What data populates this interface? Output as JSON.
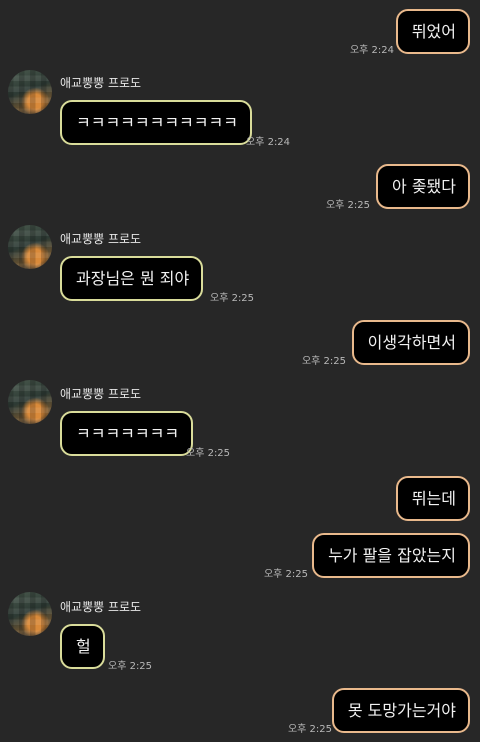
{
  "sender_name": "애교뿡뿡 프로도",
  "messages": [
    {
      "from": "me",
      "text": "뛰었어",
      "time": "오후 2:24"
    },
    {
      "from": "them",
      "text": "ㅋㅋㅋㅋㅋㅋㅋㅋㅋㅋㅋ",
      "time": "오후 2:24"
    },
    {
      "from": "me",
      "text": "아 좆됐다",
      "time": "오후 2:25"
    },
    {
      "from": "them",
      "text": "과장님은 뭔 죄야",
      "time": "오후 2:25"
    },
    {
      "from": "me",
      "text": "이생각하면서",
      "time": "오후 2:25"
    },
    {
      "from": "them",
      "text": "ㅋㅋㅋㅋㅋㅋㅋ",
      "time": "오후 2:25"
    },
    {
      "from": "me",
      "text": "뛰는데",
      "time": ""
    },
    {
      "from": "me",
      "text": "누가 팔을 잡았는지",
      "time": "오후 2:25"
    },
    {
      "from": "them",
      "text": "헐",
      "time": "오후 2:25"
    },
    {
      "from": "me",
      "text": "못 도망가는거야",
      "time": "오후 2:25"
    }
  ],
  "colors": {
    "background": "#272727",
    "bubble_fill": "#000000",
    "my_border": "#e9b98c",
    "their_border": "#d9dc9a"
  }
}
